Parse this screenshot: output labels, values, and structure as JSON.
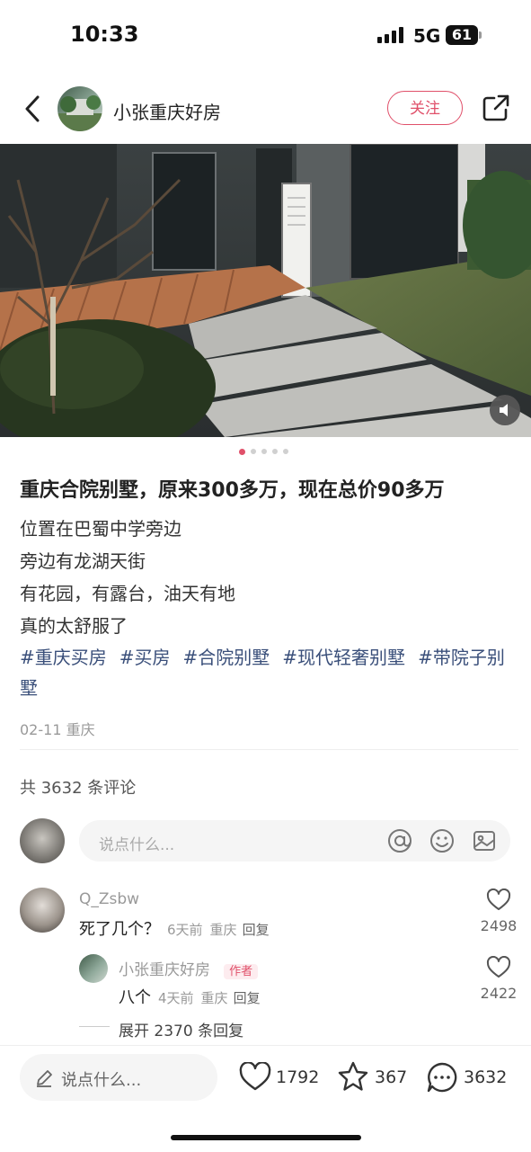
{
  "status_bar": {
    "time": "10:33",
    "network": "5G",
    "battery": "61"
  },
  "header": {
    "author": "小张重庆好房",
    "follow_label": "关注"
  },
  "carousel": {
    "total": 5,
    "active": 0
  },
  "post": {
    "title": "重庆合院别墅，原来300多万，现在总价90多万",
    "lines": [
      "位置在巴蜀中学旁边",
      "旁边有龙湖天街",
      "有花园，有露台，油天有地",
      "真的太舒服了"
    ],
    "tags": [
      "#重庆买房",
      "#买房",
      "#合院别墅",
      "#现代轻奢别墅",
      "#带院子别墅"
    ],
    "date_location": "02-11 重庆"
  },
  "comments_section": {
    "count_label": "共 3632 条评论",
    "input_placeholder": "说点什么...",
    "comments": [
      {
        "user": "Q_Zsbw",
        "text": "死了几个？",
        "time": "6天前",
        "location": "重庆",
        "reply": "回复",
        "likes": "2498"
      }
    ],
    "replies": [
      {
        "user": "小张重庆好房",
        "badge": "作者",
        "text": "八个",
        "time": "4天前",
        "location": "重庆",
        "reply": "回复",
        "likes": "2422"
      }
    ],
    "expand_label": "展开 2370 条回复"
  },
  "bottom_bar": {
    "input_placeholder": "说点什么...",
    "likes": "1792",
    "collects": "367",
    "comments": "3632"
  },
  "colors": {
    "accent": "#e0506a",
    "tag": "#3a4f7a"
  },
  "icons": [
    "back-icon",
    "share-icon",
    "sound-icon",
    "at-icon",
    "emoji-icon",
    "image-icon",
    "heart-icon",
    "star-icon",
    "comment-icon",
    "pencil-icon"
  ]
}
